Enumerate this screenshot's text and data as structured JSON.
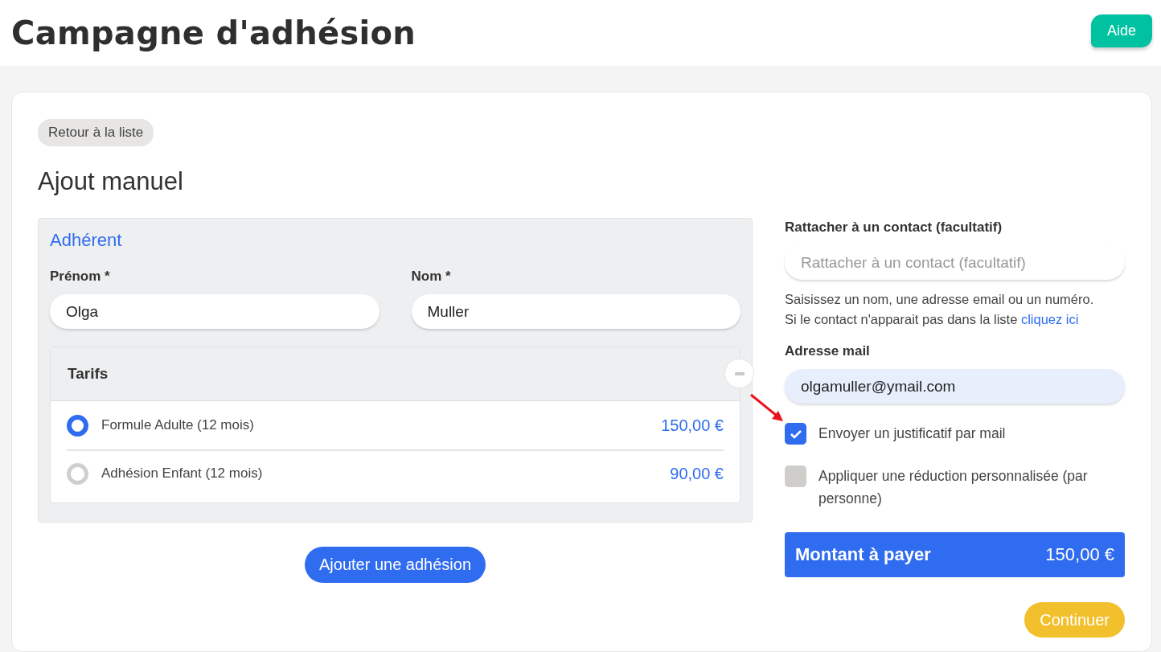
{
  "header": {
    "title": "Campagne d'adhésion",
    "help_button": "Aide"
  },
  "back_button": "Retour à la liste",
  "section_title": "Ajout manuel",
  "member": {
    "title": "Adhérent",
    "fields": [
      {
        "label": "Prénom *",
        "value": "Olga"
      },
      {
        "label": "Nom *",
        "value": "Muller"
      }
    ],
    "tariffs": {
      "title": "Tarifs",
      "options": [
        {
          "label": "Formule Adulte (12 mois)",
          "price": "150,00 €",
          "selected": true
        },
        {
          "label": "Adhésion Enfant (12 mois)",
          "price": "90,00 €",
          "selected": false
        }
      ]
    }
  },
  "add_button": "Ajouter une adhésion",
  "contact": {
    "label": "Rattacher à un contact (facultatif)",
    "placeholder": "Rattacher à un contact (facultatif)",
    "help_lines": [
      "Saisissez un nom, une adresse email ou un numéro.",
      "Si le contact n'apparait pas dans la liste "
    ],
    "help_link": "cliquez ici"
  },
  "email": {
    "label": "Adresse mail",
    "value": "olgamuller@ymail.com"
  },
  "options": [
    {
      "label": "Envoyer un justificatif par mail",
      "checked": true,
      "annotated": true
    },
    {
      "label": "Appliquer une réduction personnalisée (par personne)",
      "checked": false,
      "annotated": false
    }
  ],
  "total": {
    "label": "Montant à payer",
    "amount": "150,00 €"
  },
  "continue_button": "Continuer"
}
